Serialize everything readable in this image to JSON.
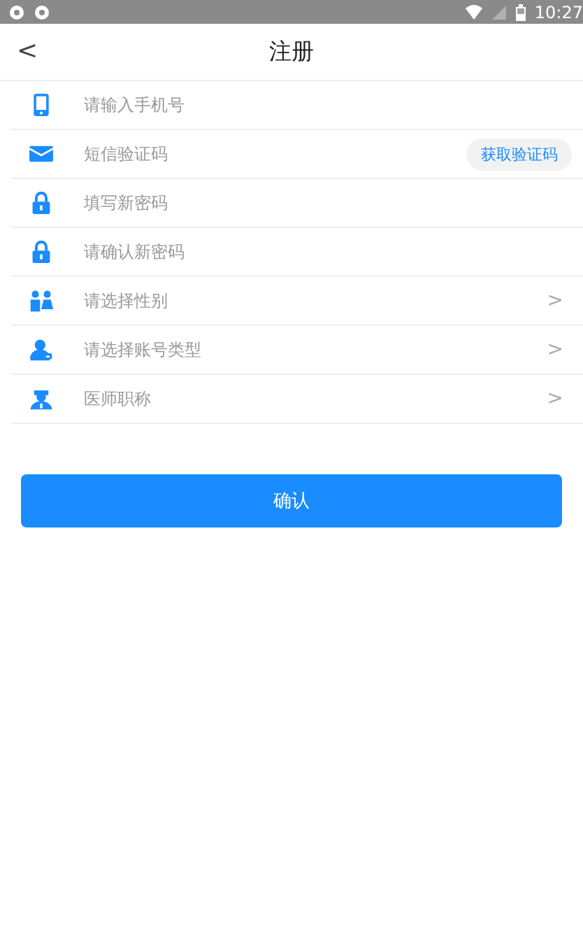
{
  "status_bar": {
    "time": "10:27"
  },
  "header": {
    "back": "<",
    "title": "注册"
  },
  "rows": [
    {
      "kind": "input",
      "placeholder": "请输入手机号"
    },
    {
      "kind": "input",
      "placeholder": "短信验证码",
      "action": "获取验证码"
    },
    {
      "kind": "input",
      "placeholder": "填写新密码"
    },
    {
      "kind": "input",
      "placeholder": "请确认新密码"
    },
    {
      "kind": "select",
      "label": "请选择性别",
      "chevron": ">"
    },
    {
      "kind": "select",
      "label": "请选择账号类型",
      "chevron": ">"
    },
    {
      "kind": "select",
      "label": "医师职称",
      "chevron": ">"
    }
  ],
  "submit": "确认"
}
